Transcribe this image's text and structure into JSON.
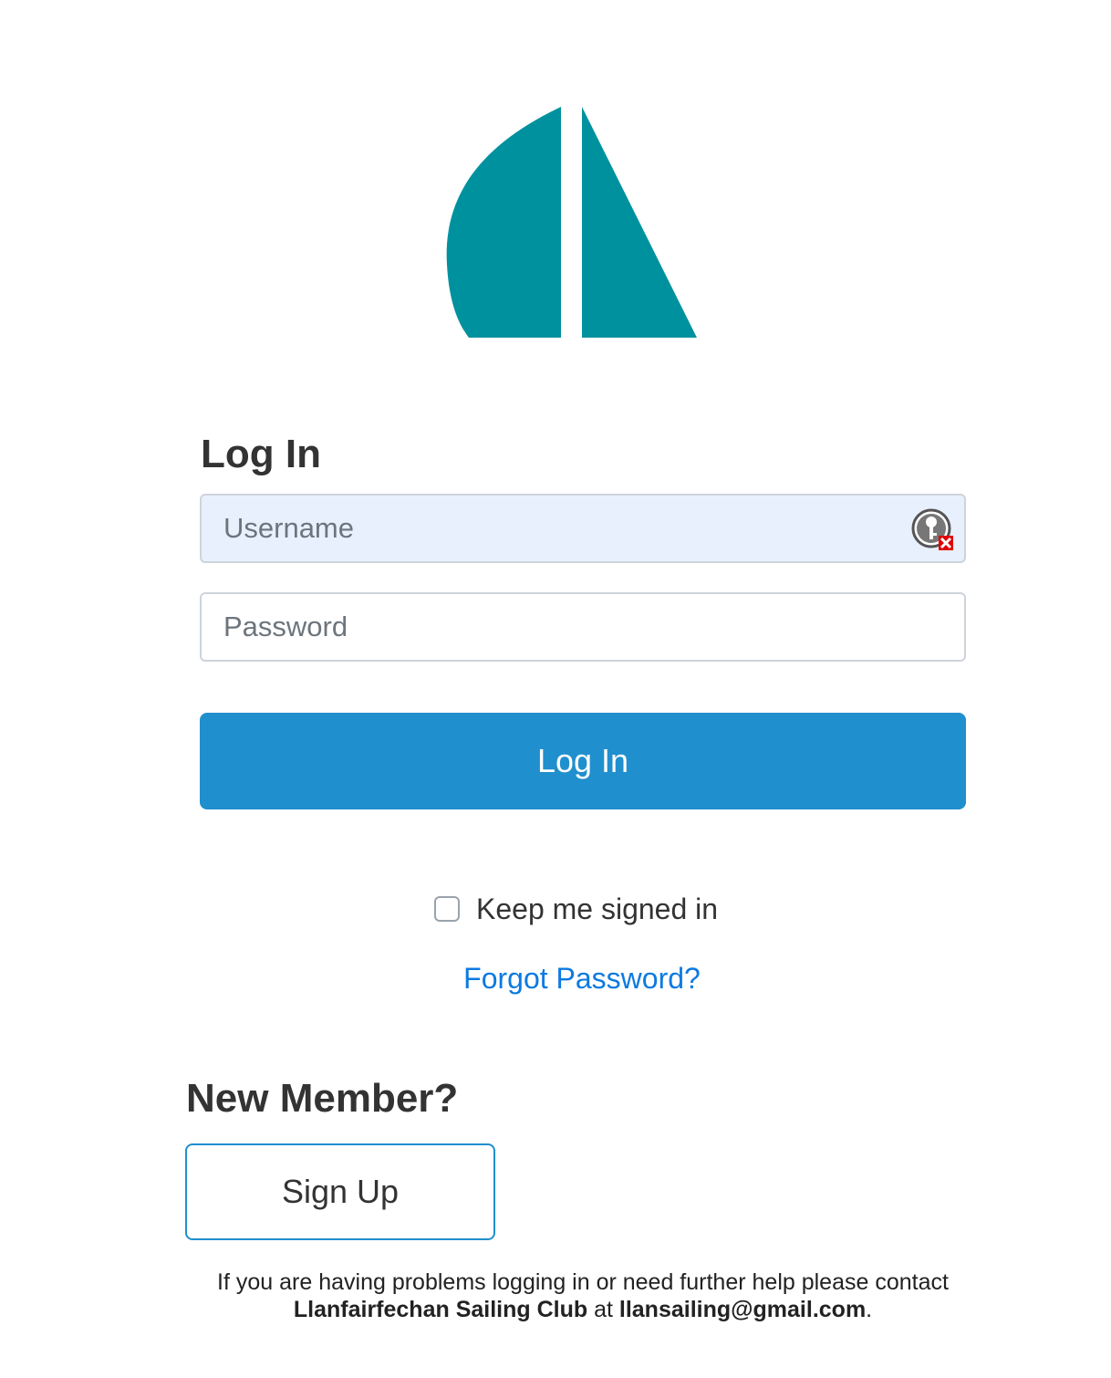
{
  "logo": {
    "icon": "sailboat-logo-icon",
    "color": "#00919f"
  },
  "login": {
    "heading": "Log In",
    "username_placeholder": "Username",
    "password_placeholder": "Password",
    "password_manager_icon": "key-password-manager-icon",
    "submit_label": "Log In",
    "keep_signed_in_label": "Keep me signed in",
    "keep_signed_in_checked": false,
    "forgot_password_label": "Forgot Password?"
  },
  "signup": {
    "heading": "New Member?",
    "button_label": "Sign Up"
  },
  "help": {
    "text_before": "If you are having problems logging in or need further help please contact ",
    "club_name": "Llanfairfechan Sailing Club",
    "text_middle": " at ",
    "email": "llansailing@gmail.com",
    "text_after": "."
  },
  "colors": {
    "primary": "#208fce",
    "link": "#0d7ae0",
    "brand": "#00919f",
    "autofill_bg": "#e8f0fe"
  }
}
